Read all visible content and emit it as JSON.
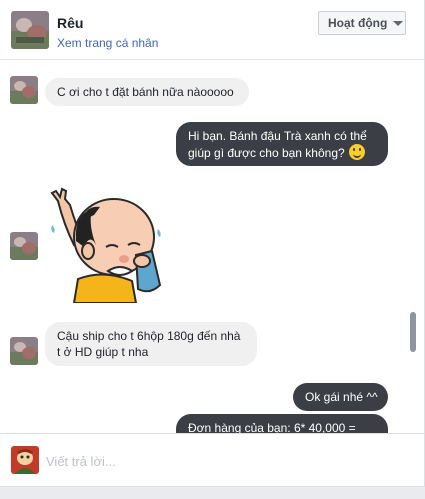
{
  "header": {
    "name": "Rêu",
    "profile_link": "Xem trang cá nhân",
    "status_button": "Hoạt động"
  },
  "messages": [
    {
      "direction": "in",
      "text": "C ơi cho t đặt bánh nữa nàooooo"
    },
    {
      "direction": "out",
      "text": "Hi bạn. Bánh đậu Trà xanh có thể giúp gì được cho bạn không?",
      "emoji": "grinning-face"
    },
    {
      "direction": "in",
      "type": "sticker",
      "sticker": "crying-bald-man-wiping-tears-sticker"
    },
    {
      "direction": "in",
      "text": "Cậu ship cho t 6hộp 180g đến nhà t ở HD giúp t nha"
    },
    {
      "direction": "out",
      "text": "Ok gái nhé ^^"
    },
    {
      "direction": "out",
      "text": "Đơn hàng của bạn: 6* 40,000 ="
    }
  ],
  "composer": {
    "placeholder": "Viết trả lời..."
  },
  "colors": {
    "outgoing_bubble": "#3b3f45",
    "incoming_bubble": "#f1f0f0",
    "link": "#4267b2"
  }
}
